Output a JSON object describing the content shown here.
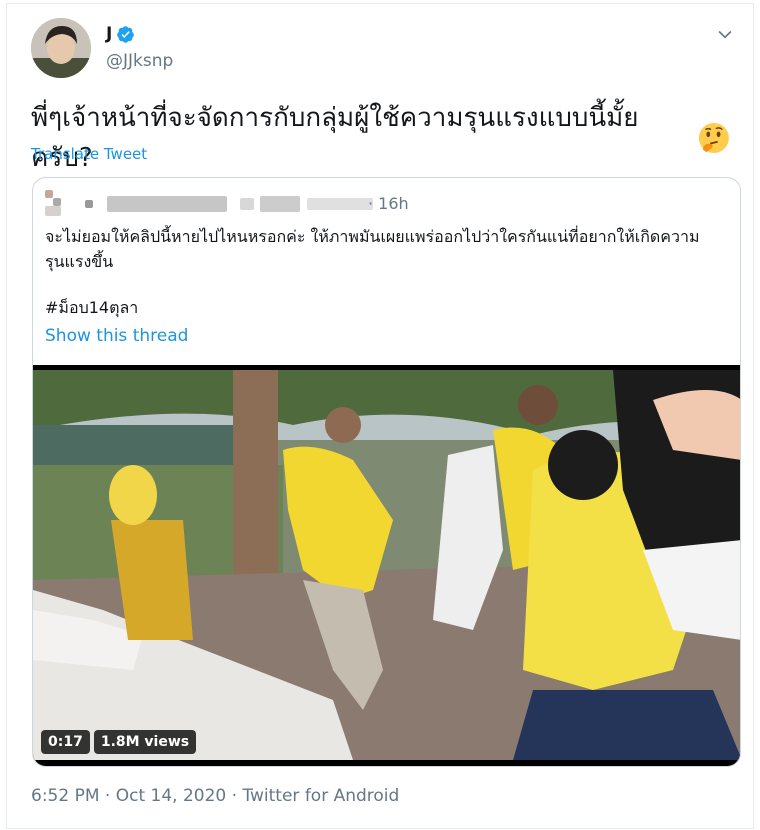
{
  "tweet": {
    "display_name": "J",
    "handle": "@JJksnp",
    "text": "พี่ๆเจ้าหน้าที่จะจัดการกับกลุ่มผู้ใช้ความรุนแรงแบบนี้มั้ยครับ?",
    "emoji": "thinking-face-emoji",
    "translate_label": "Translate Tweet"
  },
  "quoted": {
    "time": "· 16h",
    "text": "จะไม่ยอมให้คลิปนี้หายไปไหนหรอกค่ะ ให้ภาพมันเผยแพร่ออกไปว่าใครกันแน่ที่อยากให้เกิดความรุนแรงขึ้น",
    "hashtag": "#ม็อบ14ตุลา",
    "show_thread": "Show this thread",
    "video": {
      "duration": "0:17",
      "views": "1.8M views"
    }
  },
  "footer": {
    "time": "6:52 PM",
    "date": "Oct 14, 2020",
    "source": "Twitter for Android",
    "separator": " · "
  },
  "colors": {
    "accent": "#1b95e0",
    "muted": "#657786",
    "border": "#ccd6dd"
  }
}
